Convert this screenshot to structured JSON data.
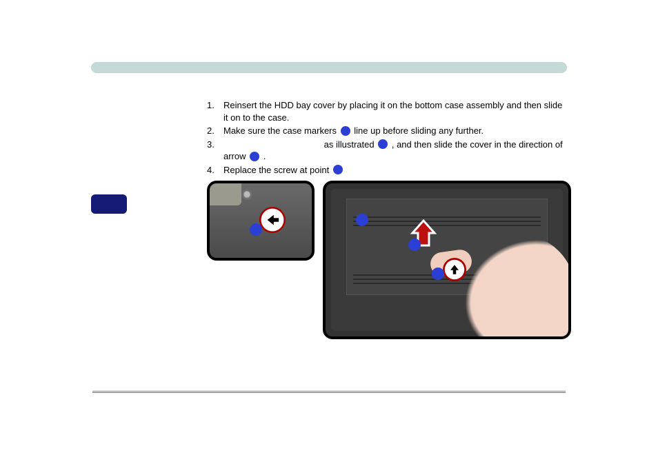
{
  "steps": [
    {
      "num": "1.",
      "text_before": "Reinsert the HDD bay cover by placing it on the bottom case assembly and then slide it on to the case.",
      "bullet_after_1": false,
      "text_mid": "",
      "bullet_after_2": false,
      "text_after": ""
    },
    {
      "num": "2.",
      "text_before": "Make sure the case markers ",
      "bullet_after_1": true,
      "text_mid": " line up before sliding any further.",
      "bullet_after_2": false,
      "text_after": ""
    },
    {
      "num": "3.",
      "text_before": "",
      "text_mid": "as illustrated ",
      "bullet_after_1": false,
      "bullet_after_2": true,
      "text_after": ", and then slide the cover in the direction of arrow ",
      "bullet_after_3": true,
      "text_tail": "."
    },
    {
      "num": "4.",
      "text_before": "Replace the screw at point ",
      "bullet_after_1": true,
      "text_mid": "",
      "bullet_after_2": false,
      "text_after": ""
    }
  ],
  "icons": {
    "left_arrow": "←",
    "up_arrow_outline": "⬆"
  }
}
